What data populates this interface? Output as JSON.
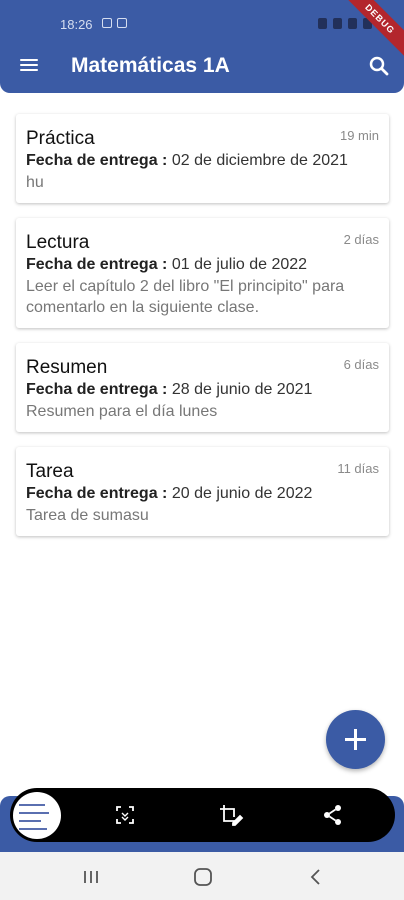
{
  "status_bar": {
    "time": "18:26"
  },
  "debug_banner": "DEBUG",
  "app_bar": {
    "title": "Matemáticas 1A"
  },
  "assignments": [
    {
      "title": "Práctica",
      "time_ago": "19 min",
      "date_label": "Fecha de entrega :",
      "date": "02 de diciembre de 2021",
      "description": "hu"
    },
    {
      "title": "Lectura",
      "time_ago": "2 días",
      "date_label": "Fecha de entrega :",
      "date": "01 de julio de 2022",
      "description": "Leer el capítulo 2 del libro \"El principito\" para comentarlo en la siguiente clase."
    },
    {
      "title": "Resumen",
      "time_ago": "6 días",
      "date_label": "Fecha de entrega :",
      "date": "28 de junio de 2021",
      "description": "Resumen para el día lunes"
    },
    {
      "title": "Tarea",
      "time_ago": "11 días",
      "date_label": "Fecha de entrega :",
      "date": "20 de junio de 2022",
      "description": "Tarea de sumasu"
    }
  ],
  "icons": {
    "menu": "menu-icon",
    "search": "search-icon",
    "add": "add-icon",
    "scan": "scroll-capture-icon",
    "edit": "crop-edit-icon",
    "share": "share-icon",
    "recents": "recents-icon",
    "home": "home-icon",
    "back": "back-icon"
  },
  "colors": {
    "primary": "#3b5ba5",
    "debug": "#b3262d"
  }
}
